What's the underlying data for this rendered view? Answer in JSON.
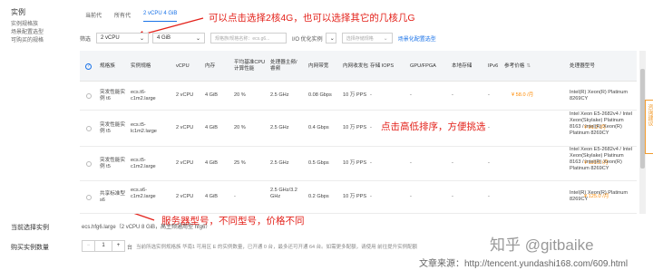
{
  "sidebar": {
    "title": "实例",
    "items": [
      "实例规格族",
      "场景配置选型",
      "可购买的规格"
    ]
  },
  "tabs": [
    "当前代",
    "所有代",
    "2 vCPU 4 GiB"
  ],
  "annotations": {
    "top": "可以点击选择2核4G，也可以选择其它的几核几G",
    "middle": "点击高低排序，方便挑选",
    "bottom": "服务器型号，不同型号，价格不同"
  },
  "filter": {
    "label": "筛选",
    "vcpu": "2 vCPU",
    "memory": "4 GiB",
    "search_placeholder": "规格族/规格名称：ecs.g6...",
    "io_label": "I/O 优化实例",
    "storage_placeholder": "选择存储规格",
    "link": "场景化配置选型"
  },
  "columns": [
    "规格族",
    "实例规格",
    "vCPU",
    "内存",
    "平均基准CPU计算性能",
    "处理器主频/睿频",
    "内网带宽",
    "内网收发包",
    "存储 IOPS",
    "GPU/FPGA",
    "本地存储",
    "IPv6",
    "参考价格",
    "处理器型号"
  ],
  "rows": [
    {
      "family": "突发性能实例 t6",
      "spec": "ecs.t6-c1m2.large",
      "vcpu": "2 vCPU",
      "mem": "4 GiB",
      "baseline": "20 %",
      "freq": "2.5 GHz",
      "bw": "0.08 Gbps",
      "pps": "10 万 PPS",
      "iops": "-",
      "gpu": "-",
      "local": "-",
      "ipv6": "-",
      "price": "¥ 58.0 /月",
      "cpu": "Intel(R) Xeon(R) Platinum 8269CY"
    },
    {
      "family": "突发性能实例 t5",
      "spec": "ecs.t5-lc1m2.large",
      "vcpu": "2 vCPU",
      "mem": "4 GiB",
      "baseline": "20 %",
      "freq": "2.5 GHz",
      "bw": "0.4 Gbps",
      "pps": "10 万 PPS",
      "iops": "-",
      "gpu": "-",
      "local": "-",
      "ipv6": "-",
      "price": "¥ 91.2 /月",
      "cpu": "Intel Xeon E5-2682v4 / Intel Xeon(Skylake) Platinum 8163 / Intel(R) Xeon(R) Platinum 8269CY"
    },
    {
      "family": "突发性能实例 t5",
      "spec": "ecs.t5-c1m2.large",
      "vcpu": "2 vCPU",
      "mem": "4 GiB",
      "baseline": "25 %",
      "freq": "2.5 GHz",
      "bw": "0.5 Gbps",
      "pps": "10 万 PPS",
      "iops": "-",
      "gpu": "-",
      "local": "-",
      "ipv6": "-",
      "price": "¥ 110.2 /月",
      "cpu": "Intel Xeon E5-2682v4 / Intel Xeon(Skylake) Platinum 8163 / Intel(R) Xeon(R) Platinum 8269CY"
    },
    {
      "family": "共享标准型 s6",
      "spec": "ecs.s6-c1m2.large",
      "vcpu": "2 vCPU",
      "mem": "4 GiB",
      "baseline": "-",
      "freq": "2.5 GHz/3.2 GHz",
      "bw": "0.2 Gbps",
      "pps": "10 万 PPS",
      "iops": "-",
      "gpu": "-",
      "local": "-",
      "ipv6": "-",
      "price": "¥ 125.0 /月",
      "cpu": "Intel(R) Xeon(R) Platinum 8269CY"
    }
  ],
  "bottom": {
    "current_label": "当前选择实例",
    "current_value": "ecs.hfg6.large（2 vCPU 8 GiB，高主频通用型 hfg6）",
    "qty_label": "购买实例数量",
    "qty_minus": "−",
    "qty_value": "1",
    "qty_plus": "+",
    "qty_unit": "台",
    "notice": "当前所选实例规格族 华南1 可用区 E 的实例数量，已开通 0 台，最多还可开通 64 台。如需更多配额，请使用 前往提升实例配额"
  },
  "watermark": {
    "zhihu": "知乎 @gitbaike",
    "source": "文章来源：http://tencent.yundashi168.com/609.html"
  },
  "feedback_text": "咨询建议",
  "colors": {
    "accent": "#1a73e8",
    "annotation": "#e3211a",
    "price": "#ff8a00"
  }
}
